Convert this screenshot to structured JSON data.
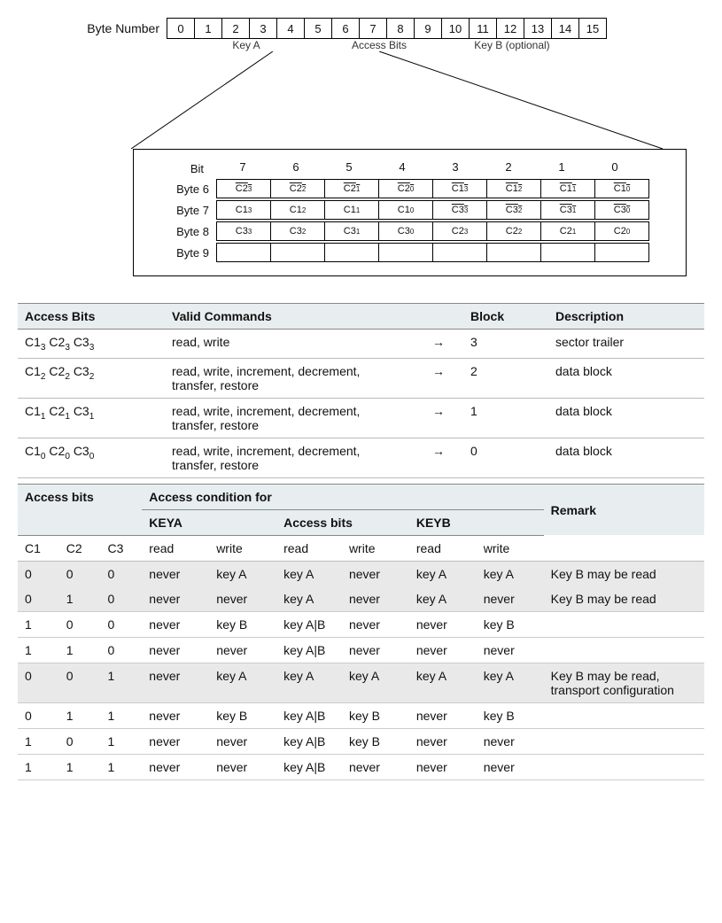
{
  "byteStrip": {
    "label": "Byte Number",
    "cells": [
      "0",
      "1",
      "2",
      "3",
      "4",
      "5",
      "6",
      "7",
      "8",
      "9",
      "10",
      "11",
      "12",
      "13",
      "14",
      "15"
    ],
    "groupA": "Key A",
    "groupB": "Access Bits",
    "groupC": "Key B (optional)"
  },
  "detail": {
    "bitLabel": "Bit",
    "bitHeaders": [
      "7",
      "6",
      "5",
      "4",
      "3",
      "2",
      "1",
      "0"
    ],
    "rows": [
      {
        "label": "Byte 6",
        "cells": [
          {
            "t": "C2",
            "s": "3",
            "o": true
          },
          {
            "t": "C2",
            "s": "2",
            "o": true
          },
          {
            "t": "C2",
            "s": "1",
            "o": true
          },
          {
            "t": "C2",
            "s": "0",
            "o": true
          },
          {
            "t": "C1",
            "s": "3",
            "o": true
          },
          {
            "t": "C1",
            "s": "2",
            "o": true
          },
          {
            "t": "C1",
            "s": "1",
            "o": true
          },
          {
            "t": "C1",
            "s": "0",
            "o": true
          }
        ]
      },
      {
        "label": "Byte 7",
        "cells": [
          {
            "t": "C1",
            "s": "3",
            "o": false
          },
          {
            "t": "C1",
            "s": "2",
            "o": false
          },
          {
            "t": "C1",
            "s": "1",
            "o": false
          },
          {
            "t": "C1",
            "s": "0",
            "o": false
          },
          {
            "t": "C3",
            "s": "3",
            "o": true
          },
          {
            "t": "C3",
            "s": "2",
            "o": true
          },
          {
            "t": "C3",
            "s": "1",
            "o": true
          },
          {
            "t": "C3",
            "s": "0",
            "o": true
          }
        ]
      },
      {
        "label": "Byte 8",
        "cells": [
          {
            "t": "C3",
            "s": "3",
            "o": false
          },
          {
            "t": "C3",
            "s": "2",
            "o": false
          },
          {
            "t": "C3",
            "s": "1",
            "o": false
          },
          {
            "t": "C3",
            "s": "0",
            "o": false
          },
          {
            "t": "C2",
            "s": "3",
            "o": false
          },
          {
            "t": "C2",
            "s": "2",
            "o": false
          },
          {
            "t": "C2",
            "s": "1",
            "o": false
          },
          {
            "t": "C2",
            "s": "0",
            "o": false
          }
        ]
      },
      {
        "label": "Byte 9",
        "cells": [
          {
            "t": "",
            "s": "",
            "o": false
          },
          {
            "t": "",
            "s": "",
            "o": false
          },
          {
            "t": "",
            "s": "",
            "o": false
          },
          {
            "t": "",
            "s": "",
            "o": false
          },
          {
            "t": "",
            "s": "",
            "o": false
          },
          {
            "t": "",
            "s": "",
            "o": false
          },
          {
            "t": "",
            "s": "",
            "o": false
          },
          {
            "t": "",
            "s": "",
            "o": false
          }
        ]
      }
    ]
  },
  "table1": {
    "headers": {
      "ab": "Access Bits",
      "vc": "Valid Commands",
      "arrow": "",
      "block": "Block",
      "desc": "Description"
    },
    "rows": [
      {
        "bits": [
          [
            "C1",
            "3"
          ],
          [
            "C2",
            "3"
          ],
          [
            "C3",
            "3"
          ]
        ],
        "cmd": "read, write",
        "arrow": "→",
        "block": "3",
        "desc": "sector trailer"
      },
      {
        "bits": [
          [
            "C1",
            "2"
          ],
          [
            "C2",
            "2"
          ],
          [
            "C3",
            "2"
          ]
        ],
        "cmd": "read, write, increment, decrement, transfer, restore",
        "arrow": "→",
        "block": "2",
        "desc": "data block"
      },
      {
        "bits": [
          [
            "C1",
            "1"
          ],
          [
            "C2",
            "1"
          ],
          [
            "C3",
            "1"
          ]
        ],
        "cmd": "read, write, increment, decrement, transfer, restore",
        "arrow": "→",
        "block": "1",
        "desc": "data block"
      },
      {
        "bits": [
          [
            "C1",
            "0"
          ],
          [
            "C2",
            "0"
          ],
          [
            "C3",
            "0"
          ]
        ],
        "cmd": "read, write, increment, decrement, transfer, restore",
        "arrow": "→",
        "block": "0",
        "desc": "data block"
      }
    ]
  },
  "table2": {
    "head": {
      "ab": "Access bits",
      "acf": "Access condition for",
      "remark": "Remark",
      "keya": "KEYA",
      "abits": "Access bits",
      "keyb": "KEYB",
      "c1": "C1",
      "c2": "C2",
      "c3": "C3",
      "read": "read",
      "write": "write"
    },
    "rows": [
      {
        "c": [
          "0",
          "0",
          "0"
        ],
        "v": [
          "never",
          "key A",
          "key A",
          "never",
          "key A",
          "key A"
        ],
        "r": "Key B may be read",
        "hl": true,
        "nob": true
      },
      {
        "c": [
          "0",
          "1",
          "0"
        ],
        "v": [
          "never",
          "never",
          "key A",
          "never",
          "key A",
          "never"
        ],
        "r": "Key B may be read",
        "hl": true
      },
      {
        "c": [
          "1",
          "0",
          "0"
        ],
        "v": [
          "never",
          "key B",
          "key A|B",
          "never",
          "never",
          "key B"
        ],
        "r": ""
      },
      {
        "c": [
          "1",
          "1",
          "0"
        ],
        "v": [
          "never",
          "never",
          "key A|B",
          "never",
          "never",
          "never"
        ],
        "r": ""
      },
      {
        "c": [
          "0",
          "0",
          "1"
        ],
        "v": [
          "never",
          "key A",
          "key A",
          "key A",
          "key A",
          "key A"
        ],
        "r": "Key B may be read, transport configuration",
        "hl": true
      },
      {
        "c": [
          "0",
          "1",
          "1"
        ],
        "v": [
          "never",
          "key B",
          "key A|B",
          "key B",
          "never",
          "key B"
        ],
        "r": ""
      },
      {
        "c": [
          "1",
          "0",
          "1"
        ],
        "v": [
          "never",
          "never",
          "key A|B",
          "key B",
          "never",
          "never"
        ],
        "r": ""
      },
      {
        "c": [
          "1",
          "1",
          "1"
        ],
        "v": [
          "never",
          "never",
          "key A|B",
          "never",
          "never",
          "never"
        ],
        "r": ""
      }
    ]
  }
}
